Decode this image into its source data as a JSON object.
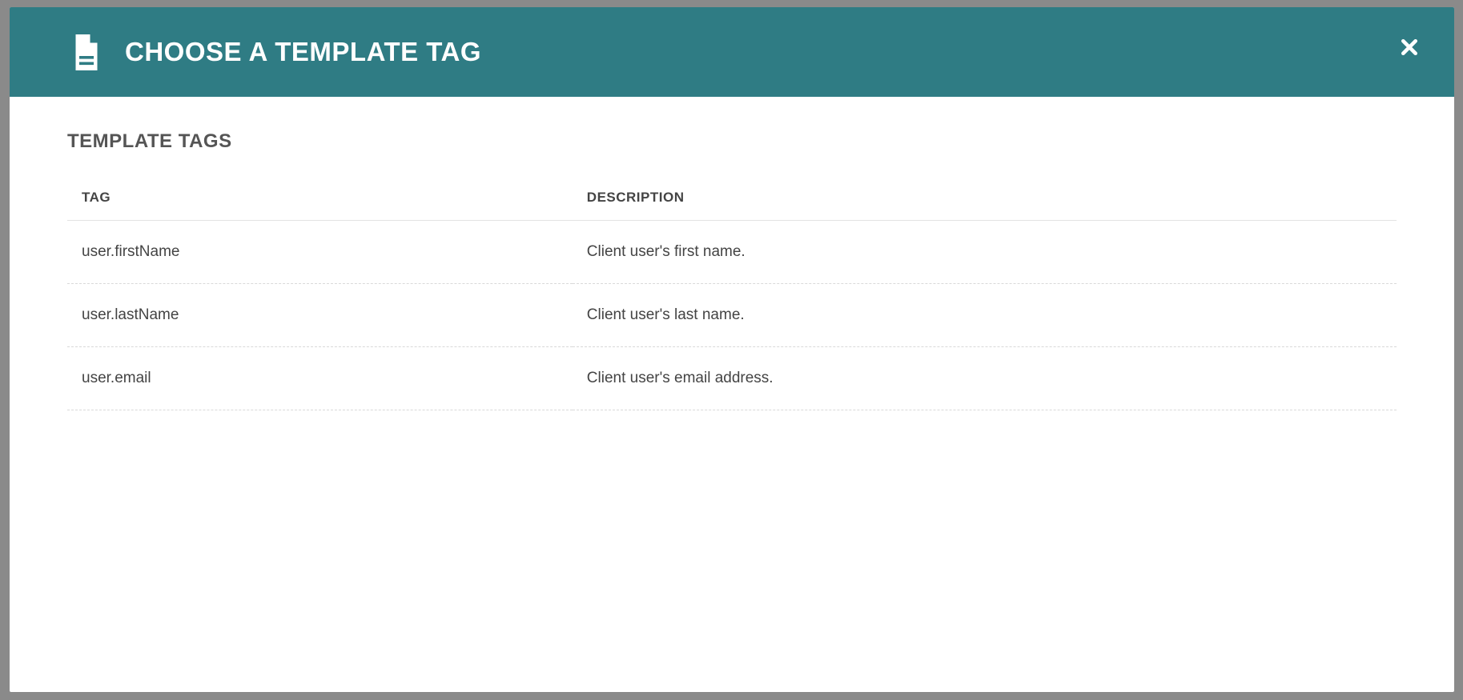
{
  "modal": {
    "title": "CHOOSE A TEMPLATE TAG",
    "section_title": "TEMPLATE TAGS",
    "columns": {
      "tag": "TAG",
      "description": "DESCRIPTION"
    },
    "rows": [
      {
        "tag": "user.firstName",
        "description": "Client user's first name."
      },
      {
        "tag": "user.lastName",
        "description": "Client user's last name."
      },
      {
        "tag": "user.email",
        "description": "Client user's email address."
      }
    ]
  },
  "icons": {
    "document": "document-icon",
    "close": "close-icon"
  }
}
